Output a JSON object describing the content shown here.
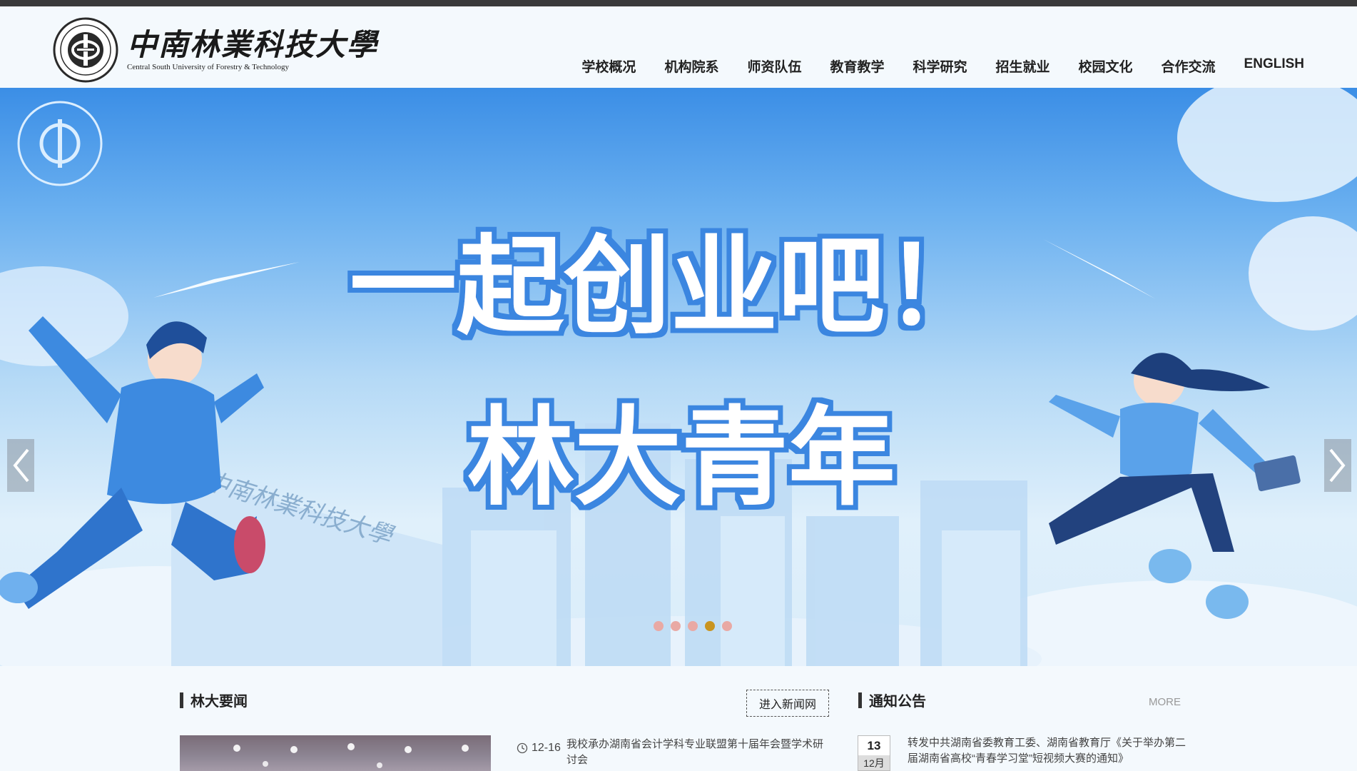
{
  "header": {
    "logo_cn": "中南林業科技大學",
    "logo_en": "Central South University of Forestry & Technology",
    "nav": [
      "学校概况",
      "机构院系",
      "师资队伍",
      "教育教学",
      "科学研究",
      "招生就业",
      "校园文化",
      "合作交流",
      "ENGLISH"
    ]
  },
  "banner": {
    "headline_1": "一起创业吧！",
    "headline_2": "林大青年",
    "slides_total": 5,
    "active_slide": 4,
    "colors": {
      "sky": "#3b8ee6",
      "text_glow": "#3b86e0",
      "active_dot": "#c99420",
      "dot": "#e9a9a4"
    }
  },
  "news": {
    "title": "林大要闻",
    "more_label": "进入新闻网",
    "items": [
      {
        "date": "12-16",
        "title": "我校承办湖南省会计学科专业联盟第十届年会暨学术研讨会"
      }
    ]
  },
  "notices": {
    "title": "通知公告",
    "more_label": "MORE",
    "items": [
      {
        "day": "13",
        "month": "12月",
        "title": "转发中共湖南省委教育工委、湖南省教育厅《关于举办第二届湖南省高校“青春学习堂”短视频大赛的通知》"
      }
    ]
  }
}
